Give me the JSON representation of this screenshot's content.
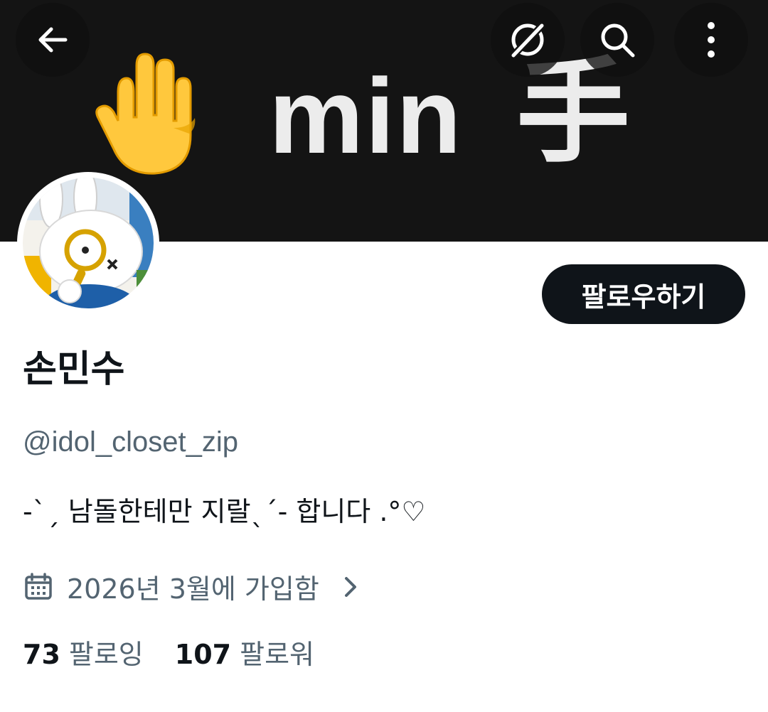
{
  "banner": {
    "text": "min",
    "kanji": "手",
    "emoji": "raised-hand"
  },
  "nav": {
    "back_icon": "back-arrow-icon",
    "grok_icon": "grok-icon",
    "search_icon": "search-icon",
    "more_icon": "more-vertical-icon"
  },
  "profile": {
    "display_name": "손민수",
    "handle": "@idol_closet_zip",
    "bio": "-ˋˏ 남돌한테만 지랄ˎˊ- 합니다 .°♡",
    "joined": "2026년 3월에 가입함",
    "follow_label": "팔로우하기"
  },
  "stats": {
    "following_count": "73",
    "following_label": "팔로잉",
    "followers_count": "107",
    "followers_label": "팔로워"
  },
  "colors": {
    "primary_text": "#0f1419",
    "secondary_text": "#536471",
    "banner_bg": "#141414",
    "button_bg": "#0f1419"
  }
}
